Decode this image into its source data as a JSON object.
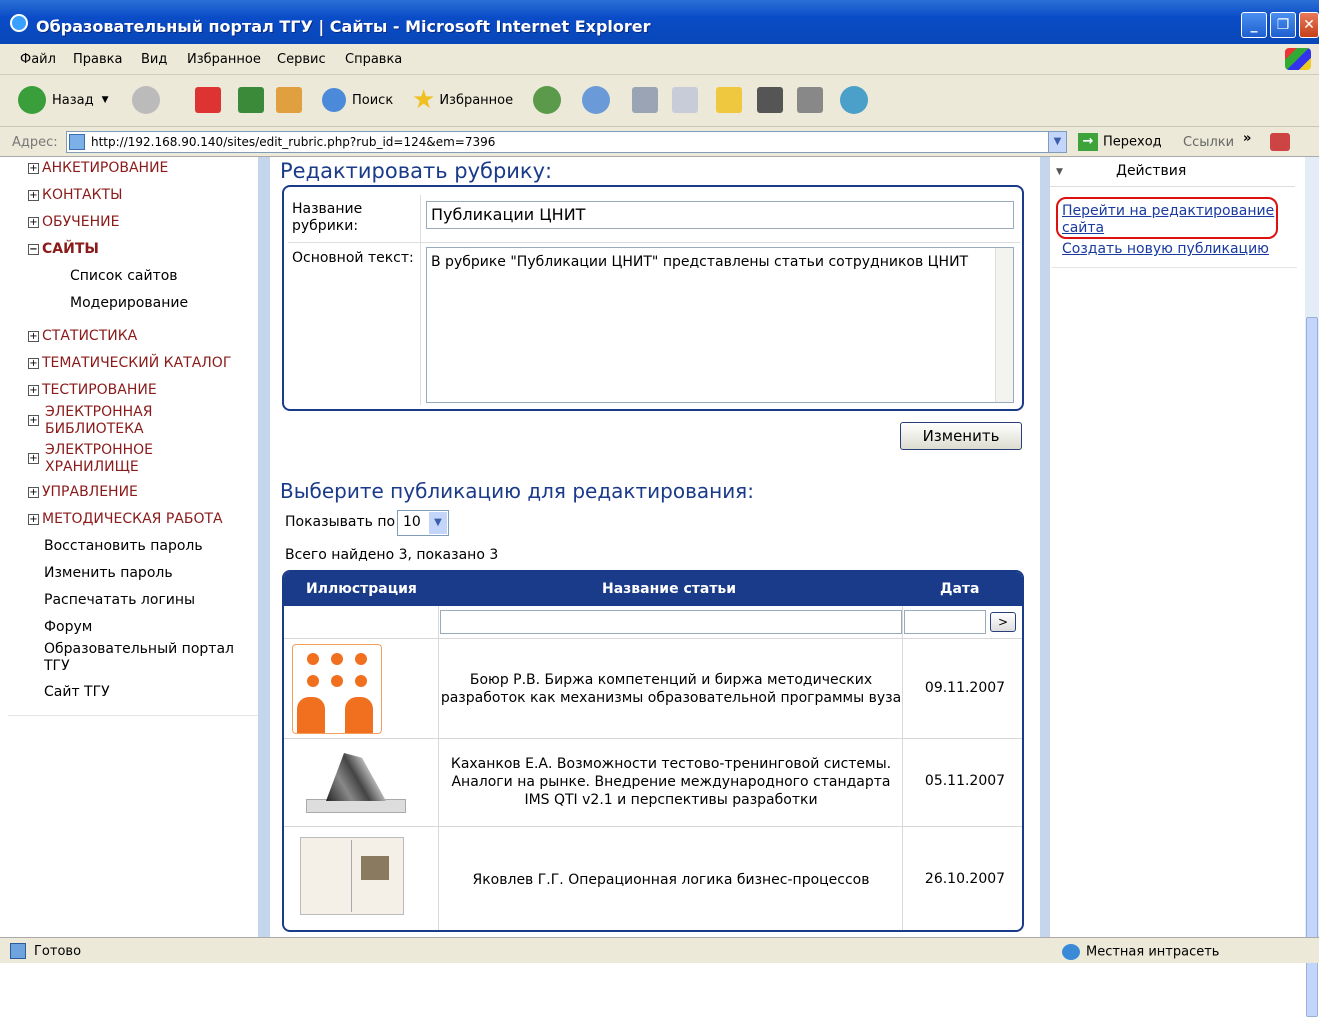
{
  "window": {
    "title": "Образовательный портал ТГУ | Сайты - Microsoft Internet Explorer"
  },
  "menu": [
    "Файл",
    "Правка",
    "Вид",
    "Избранное",
    "Сервис",
    "Справка"
  ],
  "toolbar": {
    "back": "Назад",
    "search": "Поиск",
    "favorites": "Избранное"
  },
  "address": {
    "label": "Адрес:",
    "url": "http://192.168.90.140/sites/edit_rubric.php?rub_id=124&em=7396",
    "go": "Переход",
    "links": "Ссылки"
  },
  "tree": {
    "items": [
      "АНКЕТИРОВАНИЕ",
      "КОНТАКТЫ",
      "ОБУЧЕНИЕ",
      "САЙТЫ"
    ],
    "sites_children": [
      "Список сайтов",
      "Модерирование"
    ],
    "items2": [
      "СТАТИСТИКА",
      "ТЕМАТИЧЕСКИЙ КАТАЛОГ",
      "ТЕСТИРОВАНИЕ"
    ],
    "elib": [
      "ЭЛЕКТРОННАЯ",
      "БИБЛИОТЕКА"
    ],
    "estore": [
      "ЭЛЕКТРОННОЕ",
      "ХРАНИЛИЩЕ"
    ],
    "items3": [
      "УПРАВЛЕНИЕ",
      "МЕТОДИЧЕСКАЯ РАБОТА"
    ],
    "links": [
      "Восстановить пароль",
      "Изменить пароль",
      "Распечатать логины",
      "Форум"
    ],
    "portal": [
      "Образовательный портал",
      "ТГУ"
    ],
    "site": "Сайт ТГУ"
  },
  "edit": {
    "heading": "Редактировать рубрику:",
    "name_label": [
      "Название",
      "рубрики:"
    ],
    "name_value": "Публикации ЦНИТ",
    "text_label": "Основной текст:",
    "text_value": "В рубрике \"Публикации ЦНИТ\" представлены статьи сотрудников ЦНИТ",
    "button": "Изменить"
  },
  "list": {
    "heading": "Выберите публикацию для редактирования:",
    "show_label": "Показывать по",
    "show_value": "10",
    "found": "Всего найдено 3, показано 3",
    "columns": [
      "Иллюстрация",
      "Название статьи",
      "Дата"
    ],
    "filter_button": ">",
    "rows": [
      {
        "title": [
          "Боюр Р.В. Биржа компетенций и биржа методических",
          "разработок как механизмы образовательной программы вуза"
        ],
        "date": "09.11.2007",
        "image": "people-icon"
      },
      {
        "title": [
          "Каханков Е.А. Возможности тестово-тренинговой системы.",
          "Аналоги на рынке. Внедрение международного стандарта",
          "IMS QTI v2.1 и перспективы разработки"
        ],
        "date": "05.11.2007",
        "image": "book-pages-icon"
      },
      {
        "title": [
          "Яковлев Г.Г. Операционная логика бизнес-процессов"
        ],
        "date": "26.10.2007",
        "image": "open-book-icon"
      }
    ]
  },
  "actions": {
    "heading": "Действия",
    "link1": [
      "Перейти на редактирование",
      "сайта"
    ],
    "link2": "Создать новую публикацию"
  },
  "status": {
    "text": "Готово",
    "zone": "Местная интрасеть"
  }
}
